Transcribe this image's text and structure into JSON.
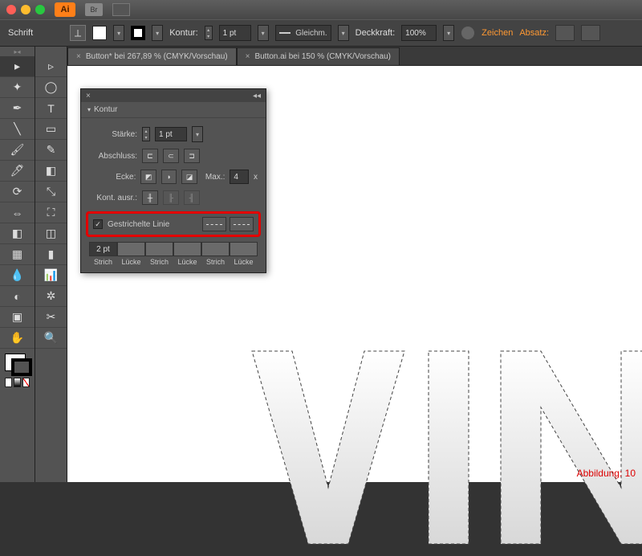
{
  "titlebar": {
    "app": "Ai",
    "br": "Br"
  },
  "options": {
    "menu_label": "Schrift",
    "stroke_label": "Kontur:",
    "stroke_weight": "1 pt",
    "stroke_style": "Gleichm.",
    "opacity_label": "Deckkraft:",
    "opacity_value": "100%",
    "link_chars": "Zeichen",
    "link_para": "Absatz:"
  },
  "tabs": [
    {
      "label": "Button* bei 267,89 % (CMYK/Vorschau)",
      "active": true
    },
    {
      "label": "Button.ai bei 150 % (CMYK/Vorschau)",
      "active": false
    }
  ],
  "panel": {
    "title": "Kontur",
    "weight_label": "Stärke:",
    "weight_value": "1 pt",
    "cap_label": "Abschluss:",
    "corner_label": "Ecke:",
    "limit_label": "Max.:",
    "limit_value": "4",
    "limit_suffix": "x",
    "align_label": "Kont. ausr.:",
    "dashed_label": "Gestrichelte Linie",
    "gap_value": "2 pt",
    "gap_labels": [
      "Strich",
      "Lücke",
      "Strich",
      "Lücke",
      "Strich",
      "Lücke"
    ]
  },
  "caption": "Abbildung: 10"
}
